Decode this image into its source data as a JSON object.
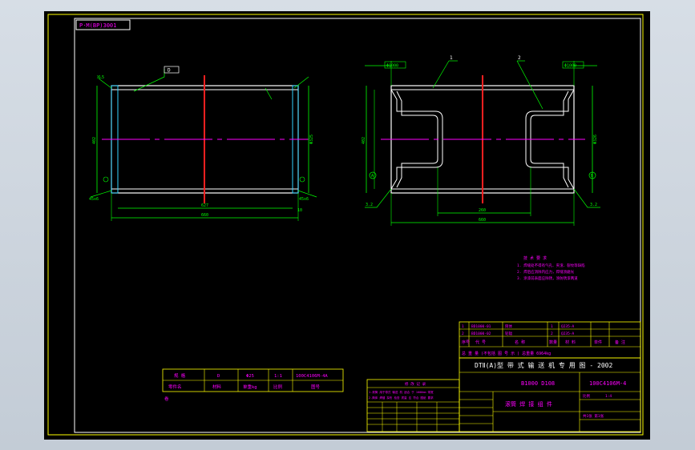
{
  "drawing": {
    "top_code": "P·M(BP)3001",
    "left_view": {
      "datum_tag": "D",
      "overall_dim": "660",
      "inner_dim": "627",
      "left_end_dim": "10",
      "right_end_dim": "10",
      "height_dim": "402",
      "dia_dim": "Φ325",
      "weld_label_tl": "XL5",
      "weld_label_bl": "45x6",
      "weld_label_br": "45x6"
    },
    "right_view": {
      "part1": "1",
      "part2": "2",
      "dim_top_left": "Φ1000",
      "dim_top_right": "Φ1000",
      "overall_dim": "660",
      "inner_dim": "260",
      "height_dim": "402",
      "dia_dim": "Φ326",
      "datum_left": "A",
      "datum_right": "B",
      "label_bl": "3.2",
      "label_br": "3.2"
    },
    "notes": {
      "title": "技 术 要 求",
      "lines": [
        "1. 焊缝处不得有气孔、夹渣、裂纹等缺陷",
        "2. 焊后应消除内应力，焊缝须磨光",
        "3. 涂漆前表面应除锈，涂防锈漆两道"
      ]
    },
    "parts_table": {
      "rows": [
        [
          "1",
          "BD1000-01",
          "筒体",
          "1",
          "Q235-A",
          "",
          ""
        ],
        [
          "2",
          "BD1000-02",
          "轮辐",
          "2",
          "Q235-A",
          "",
          ""
        ]
      ],
      "header": [
        "序号",
        "代 号",
        "名 称",
        "数量",
        "材 料",
        "单件",
        "备 注"
      ],
      "total_row": "总 重 量  (不包括 图 号 示 )    总重量 6964kg"
    },
    "title_block": {
      "project": "DTⅡ(A)型  带 式 输 送 机 专 用 图 - 2002",
      "drawing_no": "B1000 D108",
      "part_code": "100C4106M-4",
      "part_name": "滚筒 焊 接 组 件",
      "scale_label": "比例",
      "scale": "1:4",
      "sheet": "共1张 第1张"
    },
    "stamp": {
      "row1": [
        "规 格",
        "D",
        "Φ25",
        "1:1",
        "100C4106M-4A"
      ],
      "row2": [
        "零件名",
        "材料",
        "单重kg",
        "比例",
        "图号"
      ],
      "mark": "卷"
    },
    "revision": {
      "title": "修 改 记 录",
      "rows": [
        "1.滚筒 用于带式 输送 机  适合 于 1000mm 带宽",
        "2.筒体 焊缝 探伤 检查 质量 应 符合  图纸 要求"
      ]
    },
    "colors": {
      "background": "#000000",
      "outline": "#ffff00",
      "geometry": "#ffffff",
      "dimension": "#00ff00",
      "text": "#ff00ff",
      "centerline_red": "#ff2020",
      "centerline_magenta": "#ff00ff",
      "window_frame": "#c8d0da"
    }
  }
}
